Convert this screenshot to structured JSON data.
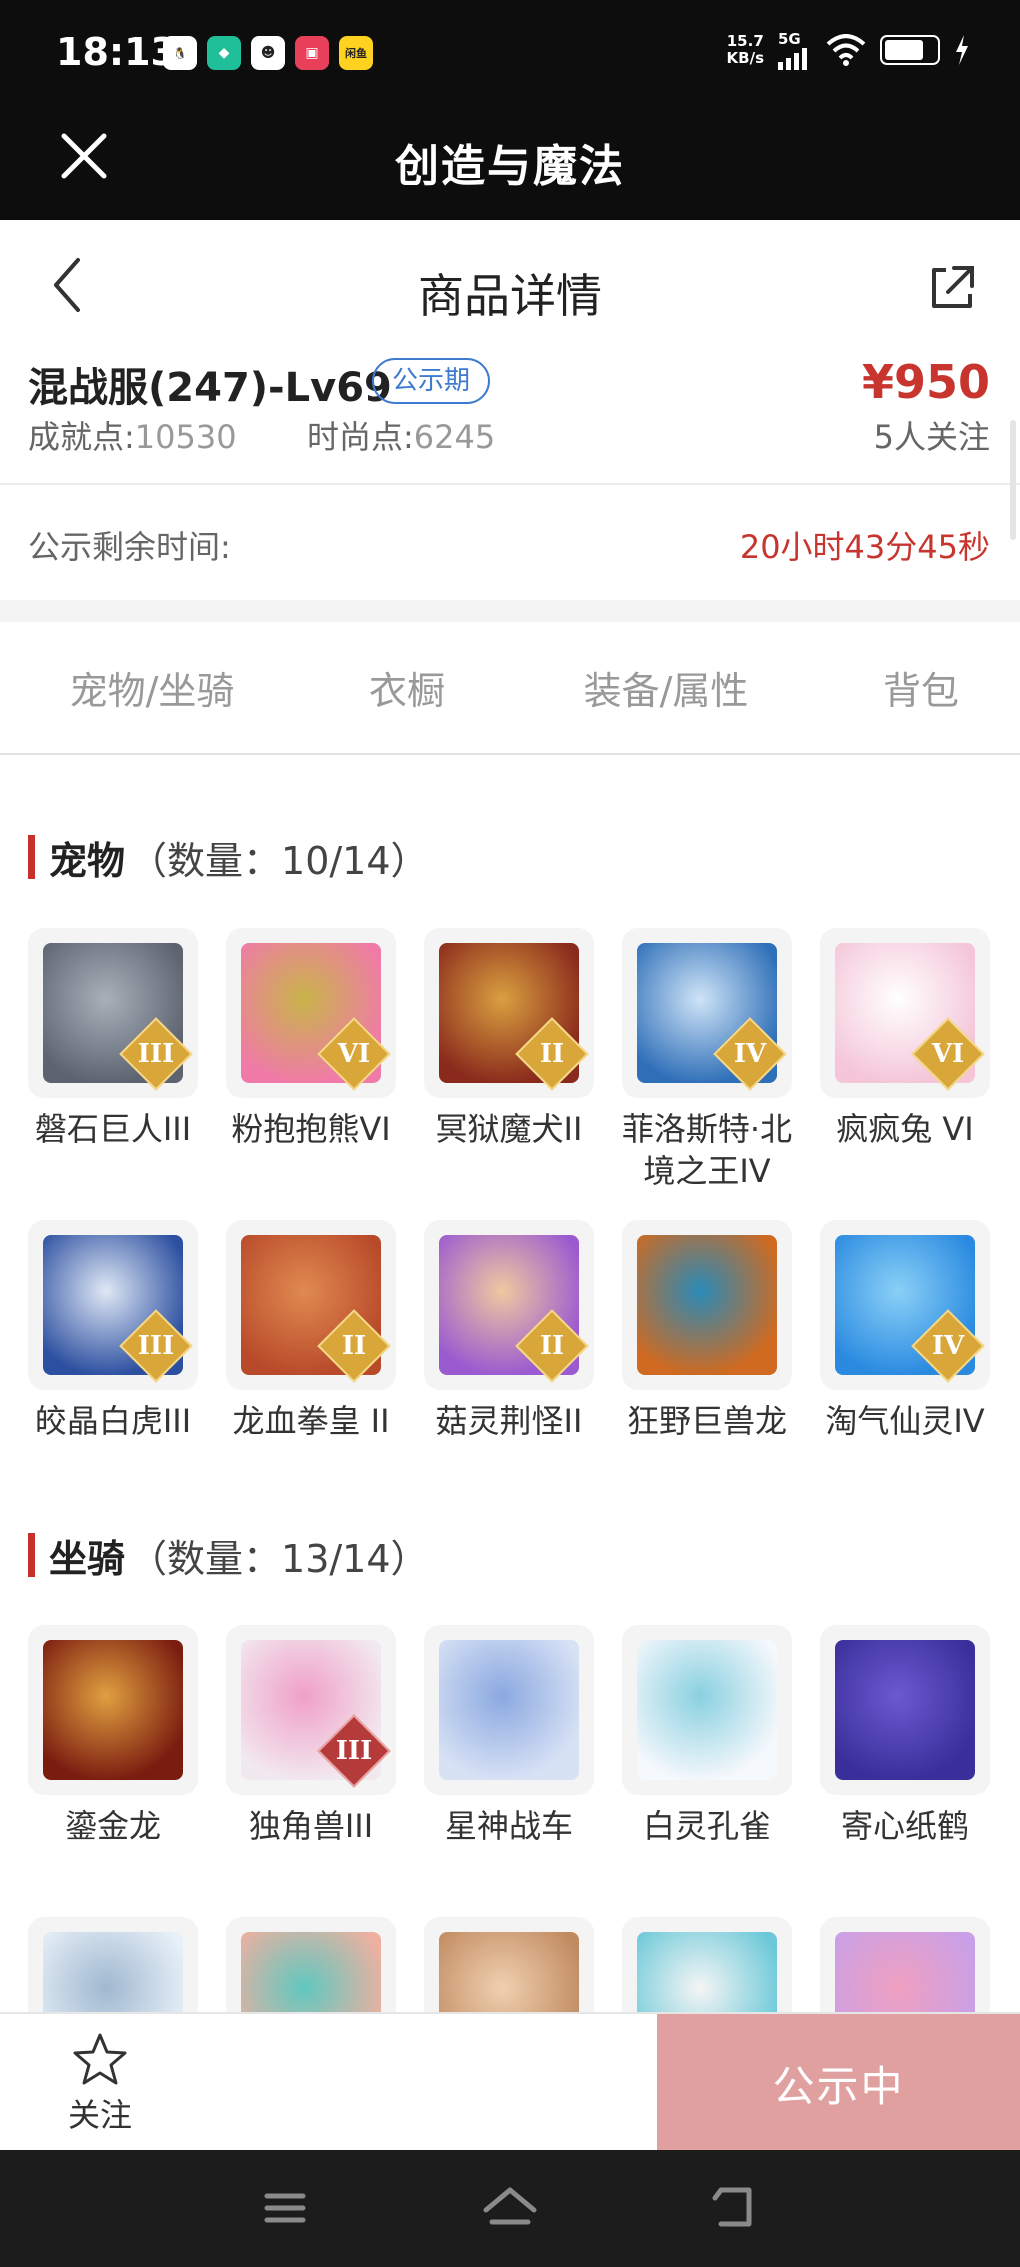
{
  "status_bar": {
    "time": "18:13",
    "apps": [
      {
        "icon": "qq-icon",
        "color": "#ffffff",
        "glyph": "🐧"
      },
      {
        "icon": "shield-app-icon",
        "color": "#1fbf9a",
        "glyph": "◆"
      },
      {
        "icon": "mask-app-icon",
        "color": "#ffffff",
        "glyph": "☻"
      },
      {
        "icon": "shopping-app-icon",
        "color": "#e8405a",
        "glyph": "▣"
      },
      {
        "icon": "xianyu-app-icon",
        "color": "#ffd21f",
        "glyph": "闲鱼"
      }
    ],
    "net_speed": "15.7",
    "net_unit": "KB/s",
    "net_type": "5G"
  },
  "app_bar": {
    "title": "创造与魔法"
  },
  "header": {
    "title": "商品详情"
  },
  "product": {
    "name": "混战服(247)-Lv69",
    "badge": "公示期",
    "price": "¥950",
    "achievement_label": "成就点:",
    "achievement_value": "10530",
    "fashion_label": "时尚点:",
    "fashion_value": "6245",
    "followers": "5人关注",
    "remaining_label": "公示剩余时间:",
    "remaining_value": "20小时43分45秒"
  },
  "tabs": [
    {
      "label": "宠物/坐骑",
      "active": true
    },
    {
      "label": "衣橱",
      "active": false
    },
    {
      "label": "装备/属性",
      "active": false
    },
    {
      "label": "背包",
      "active": false
    }
  ],
  "pets": {
    "title": "宠物",
    "count": "（数量：10/14）",
    "items": [
      {
        "name": "磐石巨人III",
        "tier": "III",
        "colors": [
          "#5d6470",
          "#a8b0ba"
        ]
      },
      {
        "name": "粉抱抱熊VI",
        "tier": "VI",
        "colors": [
          "#f07aa8",
          "#c9b44a"
        ]
      },
      {
        "name": "冥狱魔犬II",
        "tier": "II",
        "colors": [
          "#8a2a1c",
          "#d9a040"
        ]
      },
      {
        "name": "菲洛斯特·北境之王IV",
        "tier": "IV",
        "colors": [
          "#2f6fb8",
          "#cfe4f7"
        ]
      },
      {
        "name": "疯疯兔 VI",
        "tier": "VI",
        "colors": [
          "#f4c6d8",
          "#ffffff"
        ]
      },
      {
        "name": "皎晶白虎III",
        "tier": "III",
        "colors": [
          "#2c4fa0",
          "#dfe8f5"
        ]
      },
      {
        "name": "龙血拳皇 II",
        "tier": "II",
        "colors": [
          "#b84a2a",
          "#e08a50"
        ]
      },
      {
        "name": "菇灵荆怪II",
        "tier": "II",
        "colors": [
          "#9a5ad0",
          "#f0c8a0"
        ]
      },
      {
        "name": "狂野巨兽龙",
        "tier": "",
        "colors": [
          "#d06a20",
          "#2a8ab8"
        ]
      },
      {
        "name": "淘气仙灵IV",
        "tier": "IV",
        "colors": [
          "#2a8ae0",
          "#8ad0f7"
        ]
      }
    ]
  },
  "mounts": {
    "title": "坐骑",
    "count": "（数量：13/14）",
    "items": [
      {
        "name": "鎏金龙",
        "tier": "",
        "colors": [
          "#7a1c10",
          "#e0a040"
        ]
      },
      {
        "name": "独角兽III",
        "tier": "III",
        "colors": [
          "#f2e8ef",
          "#f0a0c8"
        ]
      },
      {
        "name": "星神战车",
        "tier": "",
        "colors": [
          "#d8e2f5",
          "#8aa8e0"
        ]
      },
      {
        "name": "白灵孔雀",
        "tier": "",
        "colors": [
          "#f5f8fc",
          "#8ad0e0"
        ]
      },
      {
        "name": "寄心纸鹤",
        "tier": "",
        "colors": [
          "#3a2e9a",
          "#6a5ad0"
        ]
      },
      {
        "name": "",
        "tier": "",
        "colors": [
          "#e8f0f8",
          "#a0b8d0"
        ]
      },
      {
        "name": "",
        "tier": "",
        "colors": [
          "#f0b0a0",
          "#60c8c0"
        ]
      },
      {
        "name": "",
        "tier": "",
        "colors": [
          "#c08a60",
          "#f0d0b0"
        ]
      },
      {
        "name": "",
        "tier": "",
        "colors": [
          "#6ac8d8",
          "#f5f5f5"
        ]
      },
      {
        "name": "",
        "tier": "",
        "colors": [
          "#c8a0e8",
          "#f0a0c0"
        ]
      }
    ]
  },
  "bottom_bar": {
    "follow_label": "关注",
    "action_label": "公示中"
  },
  "theme": {
    "accent": "#c6312d",
    "badge_blue": "#3e7bd0",
    "action_disabled": "#e0a0a0"
  }
}
